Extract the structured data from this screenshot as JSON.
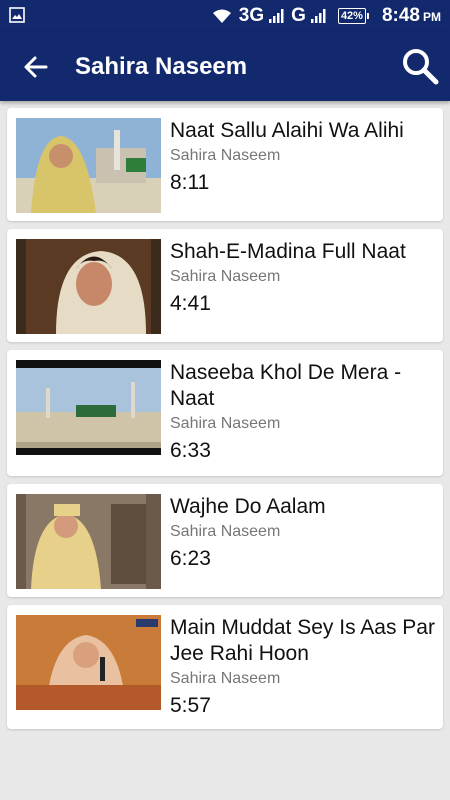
{
  "status_bar": {
    "network_1": "3G",
    "network_2": "G",
    "battery": "42%",
    "time": "8:48",
    "ampm": "PM"
  },
  "toolbar": {
    "title": "Sahira Naseem",
    "back_icon": "arrow-left-icon",
    "search_icon": "search-icon"
  },
  "videos": [
    {
      "title": "Naat Sallu Alaihi Wa Alihi",
      "artist": "Sahira Naseem",
      "duration": "8:11"
    },
    {
      "title": "Shah-E-Madina Full Naat",
      "artist": "Sahira Naseem",
      "duration": "4:41"
    },
    {
      "title": "Naseeba Khol De Mera - Naat",
      "artist": "Sahira Naseem",
      "duration": "6:33"
    },
    {
      "title": "Wajhe Do Aalam",
      "artist": "Sahira Naseem",
      "duration": "6:23"
    },
    {
      "title": "Main Muddat Sey Is Aas Par Jee Rahi Hoon",
      "artist": "Sahira Naseem",
      "duration": "5:57"
    }
  ],
  "colors": {
    "primary": "#13296d",
    "background": "#e8e8e8"
  }
}
